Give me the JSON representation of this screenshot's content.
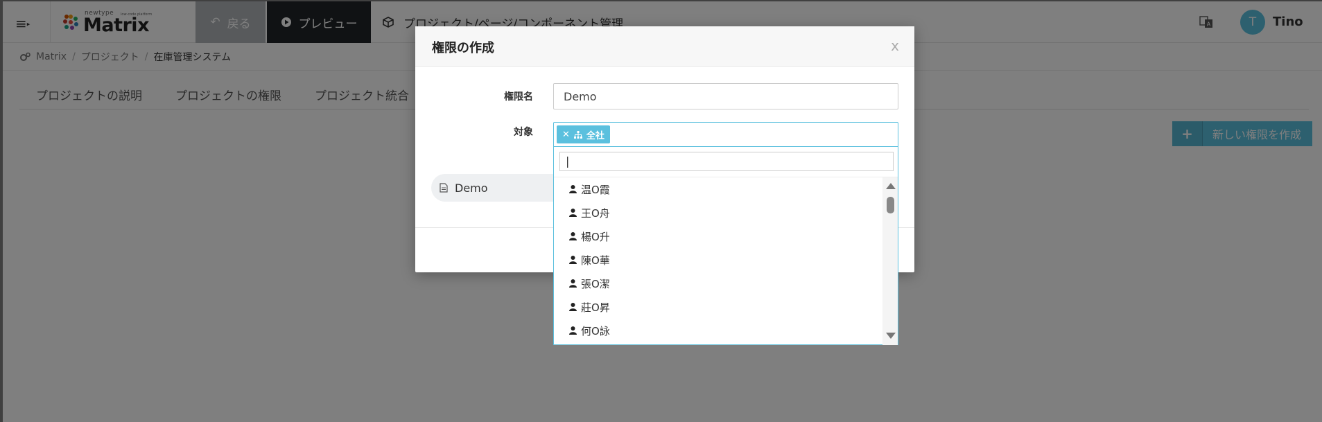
{
  "header": {
    "logo_small": "newtype",
    "logo_tagline": "low-code platform",
    "logo_main": "Matrix",
    "back_label": "戻る",
    "preview_label": "プレビュー",
    "title": "プロジェクト/ページ/コンポーネント管理",
    "user_initial": "T",
    "user_name": "Tino"
  },
  "breadcrumb": {
    "items": [
      "Matrix",
      "プロジェクト",
      "在庫管理システム"
    ]
  },
  "tabs": [
    {
      "label": "プロジェクトの説明"
    },
    {
      "label": "プロジェクトの権限"
    },
    {
      "label": "プロジェクト統合"
    }
  ],
  "actions": {
    "new_permission_label": "新しい権限を作成"
  },
  "modal": {
    "title": "権限の作成",
    "close_label": "x",
    "name_label": "権限名",
    "name_value": "Demo",
    "target_label": "対象",
    "target_tag": "全社",
    "list_item": "Demo"
  },
  "dropdown": {
    "search_value": "|",
    "options": [
      "温O霞",
      "王O舟",
      "楊O升",
      "陳O華",
      "張O潔",
      "莊O昇",
      "何O詠"
    ]
  },
  "colors": {
    "accent": "#5bc0de",
    "dark_button": "#212529",
    "back_button": "#b0b5b9",
    "overlay": "rgba(0,0,0,0.5)"
  },
  "icons": {
    "menu": "hamburger-icon",
    "back": "undo-arrow-icon",
    "preview": "play-circle-icon",
    "title": "cube-icon",
    "translate": "translate-icon",
    "breadcrumb": "gears-icon",
    "tag_remove": "times-icon",
    "tag_org": "sitemap-icon",
    "user": "user-icon",
    "file": "file-icon"
  }
}
